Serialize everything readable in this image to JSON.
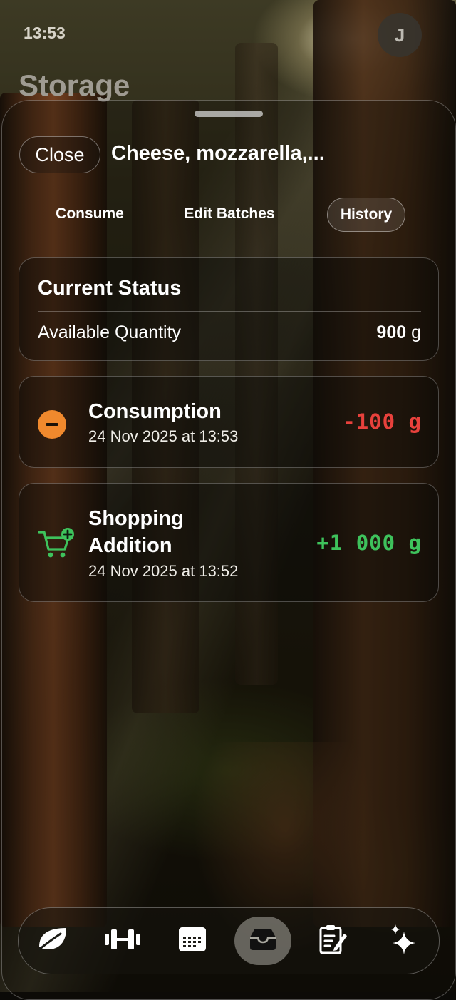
{
  "status_bar": {
    "time": "13:53"
  },
  "header": {
    "title": "Storage",
    "avatar_initial": "J"
  },
  "sheet": {
    "close_label": "Close",
    "item_title": "Cheese, mozzarella,...",
    "tabs": [
      {
        "label": "Consume",
        "selected": false
      },
      {
        "label": "Edit Batches",
        "selected": false
      },
      {
        "label": "History",
        "selected": true
      }
    ],
    "current_status": {
      "heading": "Current Status",
      "available_label": "Available Quantity",
      "available_value": "900",
      "available_unit": "g"
    },
    "history": [
      {
        "type": "consumption",
        "icon": "minus-circle-icon",
        "title": "Consumption",
        "timestamp": "24 Nov 2025 at 13:53",
        "amount": "-100 g",
        "color": "#e8413c"
      },
      {
        "type": "shopping",
        "icon": "cart-plus-icon",
        "title": "Shopping Addition",
        "timestamp": "24 Nov 2025 at 13:52",
        "amount": "+1 000 g",
        "color": "#3ec25c"
      }
    ]
  },
  "tab_bar": {
    "items": [
      {
        "icon": "leaf-icon",
        "active": false
      },
      {
        "icon": "dumbbell-icon",
        "active": false
      },
      {
        "icon": "calendar-icon",
        "active": false
      },
      {
        "icon": "tray-icon",
        "active": true
      },
      {
        "icon": "notes-edit-icon",
        "active": false
      },
      {
        "icon": "sparkles-icon",
        "active": false
      }
    ]
  },
  "colors": {
    "consume_red": "#e8413c",
    "add_green": "#3ec25c",
    "minus_orange": "#f0892d"
  }
}
